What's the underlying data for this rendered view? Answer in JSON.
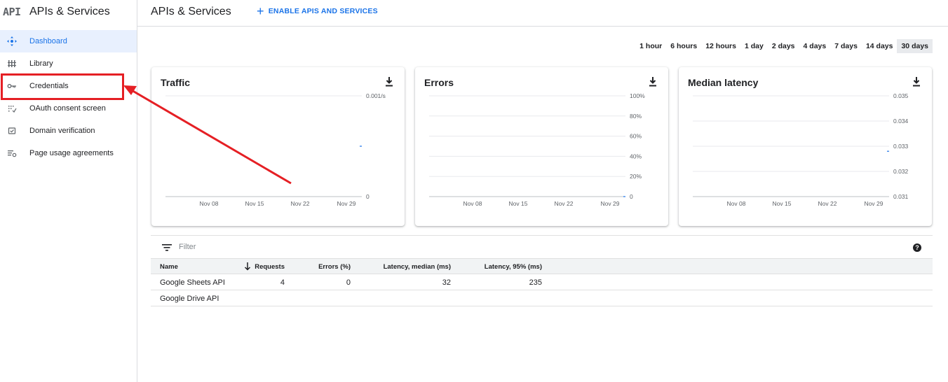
{
  "sidebar": {
    "logo": "API",
    "title": "APIs & Services",
    "items": [
      {
        "label": "Dashboard",
        "icon": "dashboard-icon",
        "active": true
      },
      {
        "label": "Library",
        "icon": "library-icon"
      },
      {
        "label": "Credentials",
        "icon": "key-icon"
      },
      {
        "label": "OAuth consent screen",
        "icon": "oauth-consent-icon"
      },
      {
        "label": "Domain verification",
        "icon": "domain-check-icon"
      },
      {
        "label": "Page usage agreements",
        "icon": "settings-list-icon"
      }
    ]
  },
  "header": {
    "title": "APIs & Services",
    "enable_label": "ENABLE APIS AND SERVICES"
  },
  "time_ranges": {
    "options": [
      "1 hour",
      "6 hours",
      "12 hours",
      "1 day",
      "2 days",
      "4 days",
      "7 days",
      "14 days",
      "30 days"
    ],
    "selected": "30 days"
  },
  "chart_data": [
    {
      "type": "line",
      "title": "Traffic",
      "x_ticks": [
        "Nov 08",
        "Nov 15",
        "Nov 22",
        "Nov 29"
      ],
      "y_ticks": [
        "0",
        "0.001/s"
      ],
      "ylim": [
        0,
        0.001
      ],
      "series": [
        {
          "points": [
            {
              "x": "Nov 30",
              "y": 0.0005
            }
          ]
        }
      ]
    },
    {
      "type": "line",
      "title": "Errors",
      "x_ticks": [
        "Nov 08",
        "Nov 15",
        "Nov 22",
        "Nov 29"
      ],
      "y_ticks": [
        "0",
        "20%",
        "40%",
        "60%",
        "80%",
        "100%"
      ],
      "ylim": [
        0,
        100
      ],
      "series": [
        {
          "points": [
            {
              "x": "Nov 30",
              "y": 0
            }
          ]
        }
      ]
    },
    {
      "type": "line",
      "title": "Median latency",
      "x_ticks": [
        "Nov 08",
        "Nov 15",
        "Nov 22",
        "Nov 29"
      ],
      "y_ticks": [
        "0.031",
        "0.032",
        "0.033",
        "0.034",
        "0.035"
      ],
      "ylim": [
        0.031,
        0.035
      ],
      "series": [
        {
          "points": [
            {
              "x": "Nov 30",
              "y": 0.0328
            }
          ]
        }
      ]
    }
  ],
  "filter": {
    "placeholder": "Filter"
  },
  "table": {
    "columns": [
      "Name",
      "Requests",
      "Errors (%)",
      "Latency, median (ms)",
      "Latency, 95% (ms)"
    ],
    "rows": [
      [
        "Google Sheets API",
        "4",
        "0",
        "32",
        "235"
      ],
      [
        "Google Drive API",
        "",
        "",
        "",
        ""
      ]
    ]
  },
  "colors": {
    "accent": "#1a73e8",
    "annotation": "#e51f24",
    "grid": "#e8eaed"
  }
}
